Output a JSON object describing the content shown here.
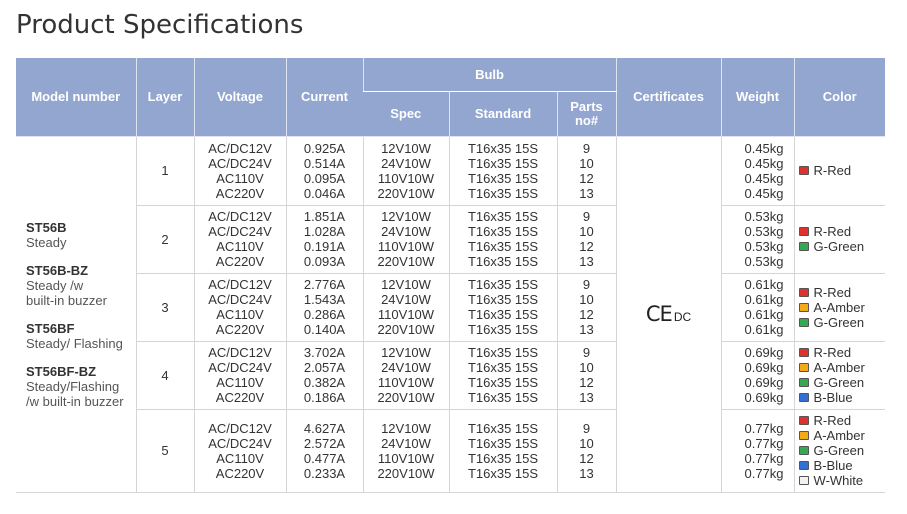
{
  "page": {
    "title": "Product Specifications"
  },
  "headers": {
    "model_number": "Model number",
    "layer": "Layer",
    "voltage": "Voltage",
    "current": "Current",
    "bulb": "Bulb",
    "spec": "Spec",
    "standard": "Standard",
    "parts_no_line1": "Parts",
    "parts_no_line2": "no#",
    "certificates": "Certificates",
    "weight": "Weight",
    "color": "Color"
  },
  "models": [
    {
      "name": "ST56B",
      "desc_lines": [
        "Steady"
      ]
    },
    {
      "name": "ST56B-BZ",
      "desc_lines": [
        "Steady /w",
        "built-in buzzer"
      ]
    },
    {
      "name": "ST56BF",
      "desc_lines": [
        "Steady/ Flashing"
      ]
    },
    {
      "name": "ST56BF-BZ",
      "desc_lines": [
        "Steady/Flashing",
        "/w built-in buzzer"
      ]
    }
  ],
  "certificate": {
    "ce": "CE",
    "dc": "DC"
  },
  "voltages": [
    "AC/DC12V",
    "AC/DC24V",
    "AC110V",
    "AC220V"
  ],
  "specs": [
    "12V10W",
    "24V10W",
    "110V10W",
    "220V10W"
  ],
  "standards": [
    "T16x35 15S",
    "T16x35 15S",
    "T16x35 15S",
    "T16x35 15S"
  ],
  "parts": [
    "9",
    "10",
    "12",
    "13"
  ],
  "color_palette": {
    "R-Red": "#e0322c",
    "A-Amber": "#f4a81c",
    "G-Green": "#34a853",
    "B-Blue": "#2f6fd6",
    "W-White": "#f2f2f2"
  },
  "rows": [
    {
      "layer": "1",
      "currents": [
        "0.925A",
        "0.514A",
        "0.095A",
        "0.046A"
      ],
      "weight": "0.45kg",
      "colors": [
        "R-Red"
      ]
    },
    {
      "layer": "2",
      "currents": [
        "1.851A",
        "1.028A",
        "0.191A",
        "0.093A"
      ],
      "weight": "0.53kg",
      "colors": [
        "R-Red",
        "G-Green"
      ]
    },
    {
      "layer": "3",
      "currents": [
        "2.776A",
        "1.543A",
        "0.286A",
        "0.140A"
      ],
      "weight": "0.61kg",
      "colors": [
        "R-Red",
        "A-Amber",
        "G-Green"
      ]
    },
    {
      "layer": "4",
      "currents": [
        "3.702A",
        "2.057A",
        "0.382A",
        "0.186A"
      ],
      "weight": "0.69kg",
      "colors": [
        "R-Red",
        "A-Amber",
        "G-Green",
        "B-Blue"
      ]
    },
    {
      "layer": "5",
      "currents": [
        "4.627A",
        "2.572A",
        "0.477A",
        "0.233A"
      ],
      "weight": "0.77kg",
      "colors": [
        "R-Red",
        "A-Amber",
        "G-Green",
        "B-Blue",
        "W-White"
      ]
    }
  ]
}
